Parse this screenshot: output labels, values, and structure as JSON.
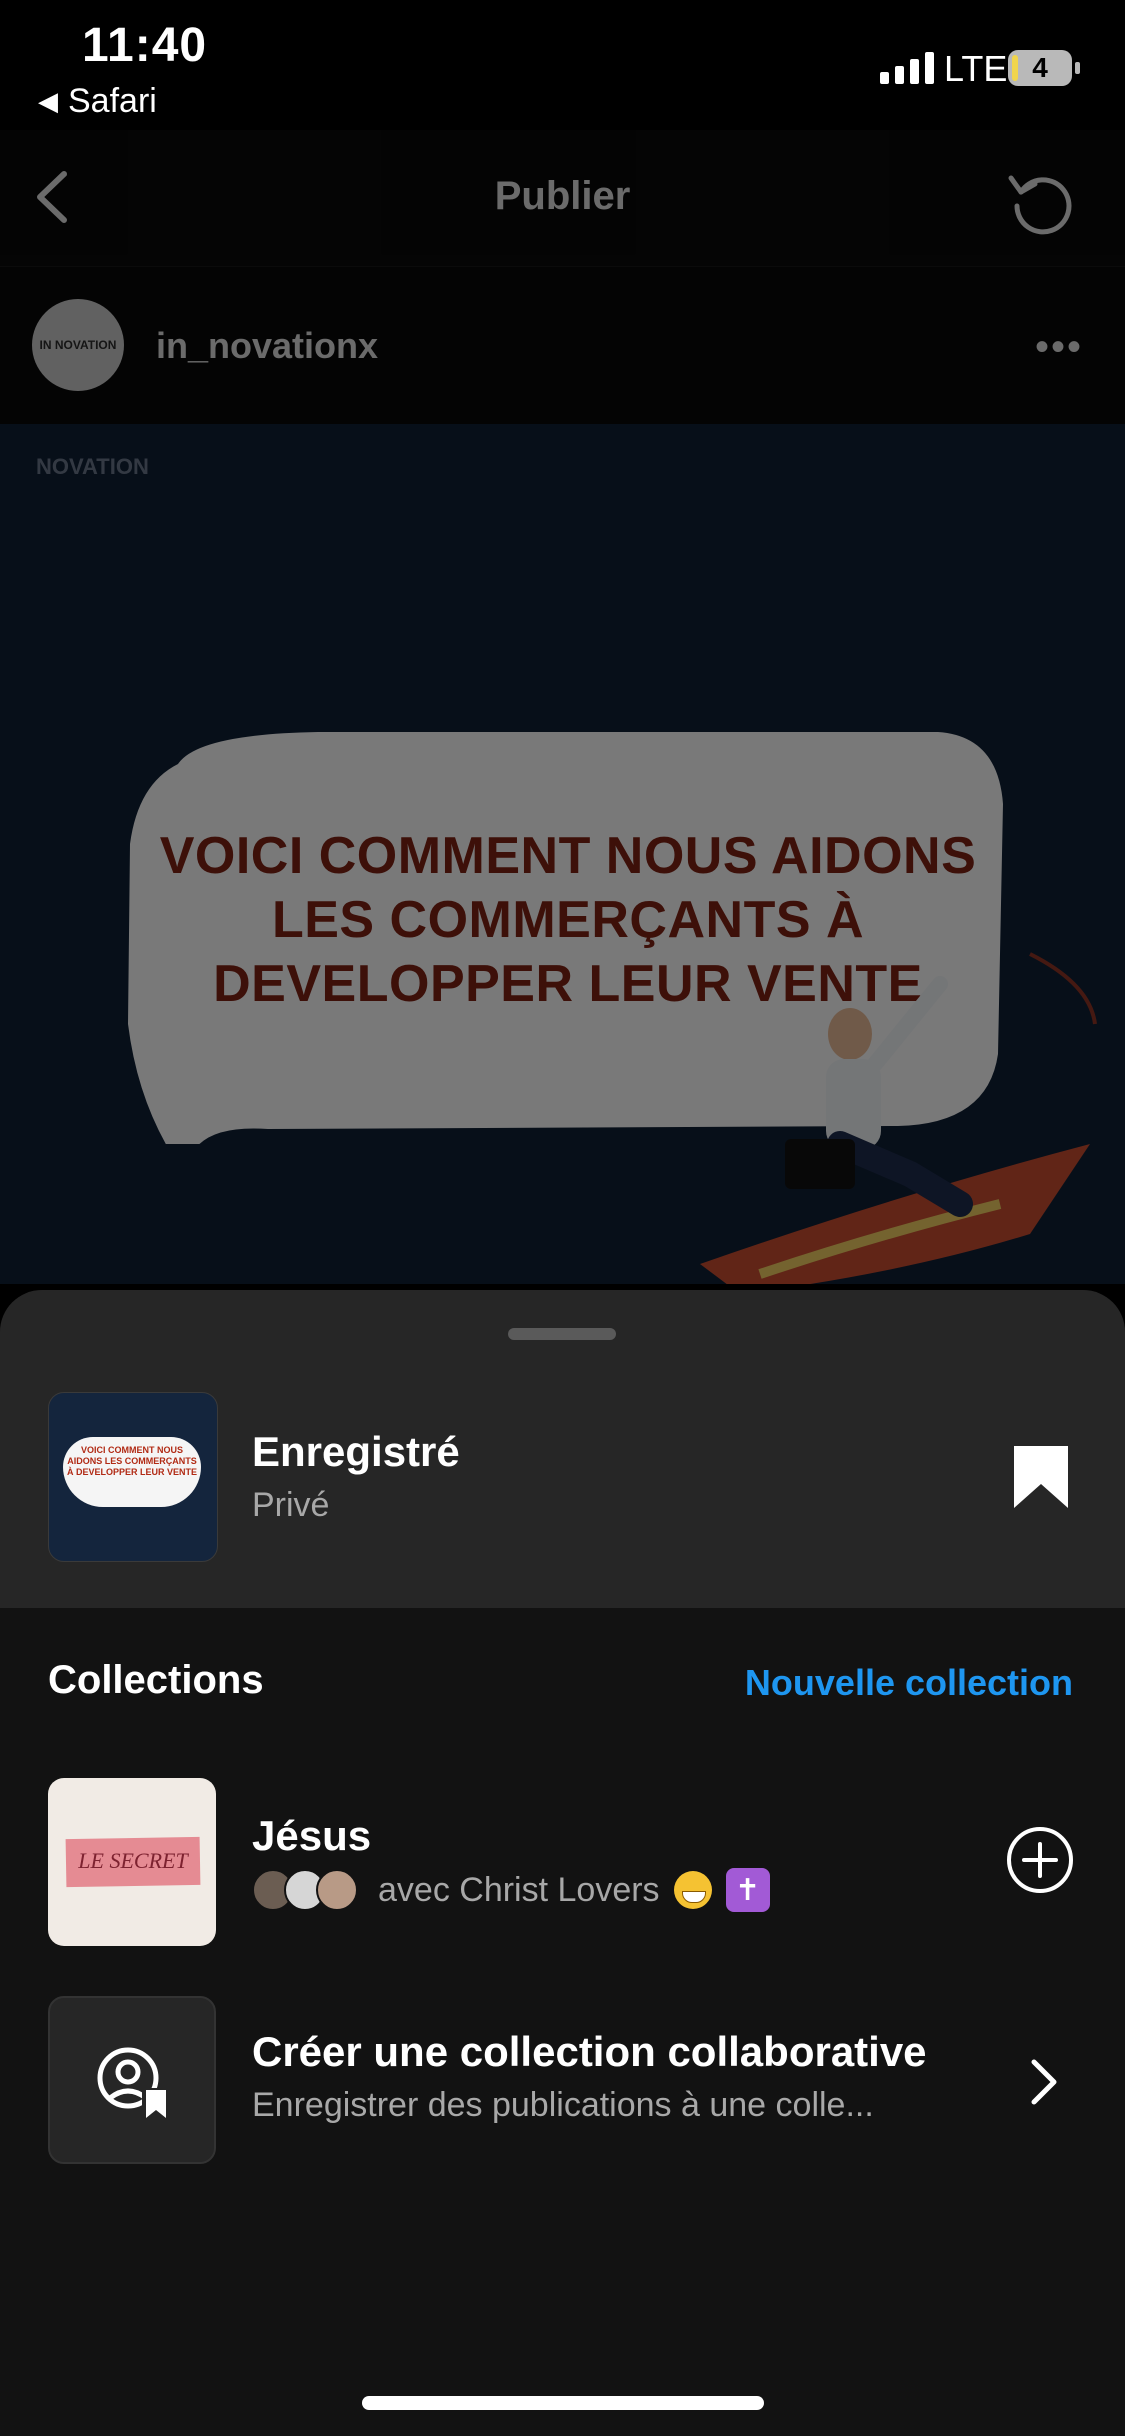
{
  "status_bar": {
    "time": "11:40",
    "back_app": "Safari",
    "network": "LTE",
    "battery": "4"
  },
  "nav": {
    "title": "Publier"
  },
  "post": {
    "username": "in_novationx",
    "avatar_text": "IN NOVATION",
    "logo_text": "NOVATION",
    "headline": "VOICI COMMENT NOUS AIDONS LES COMMERÇANTS À DEVELOPPER LEUR VENTE"
  },
  "sheet": {
    "saved_title": "Enregistré",
    "saved_subtitle": "Privé",
    "thumbnail_text": "VOICI COMMENT NOUS AIDONS LES COMMERÇANTS À DEVELOPPER LEUR VENTE",
    "collections_label": "Collections",
    "new_collection": "Nouvelle collection",
    "collections": [
      {
        "name": "Jésus",
        "thumbnail_text": "LE SECRET",
        "shared_with": "avec Christ Lovers"
      },
      {
        "name": "Créer une collection collaborative",
        "subtitle": "Enregistrer des publications à une colle..."
      }
    ]
  },
  "icons": {
    "back": "chevron-left-icon",
    "refresh": "refresh-icon",
    "more": "ellipsis-icon",
    "bookmark": "bookmark-filled-icon",
    "add": "plus-circle-icon",
    "collab": "collaborative-collection-icon",
    "chevron": "chevron-right-icon",
    "grin_emoji": "grinning-face-emoji",
    "cross_emoji": "latin-cross-emoji"
  },
  "colors": {
    "accent": "#1e96f0",
    "sheet_bg": "#121212",
    "sheet_top_bg": "#262626",
    "headline": "#7b2113"
  }
}
